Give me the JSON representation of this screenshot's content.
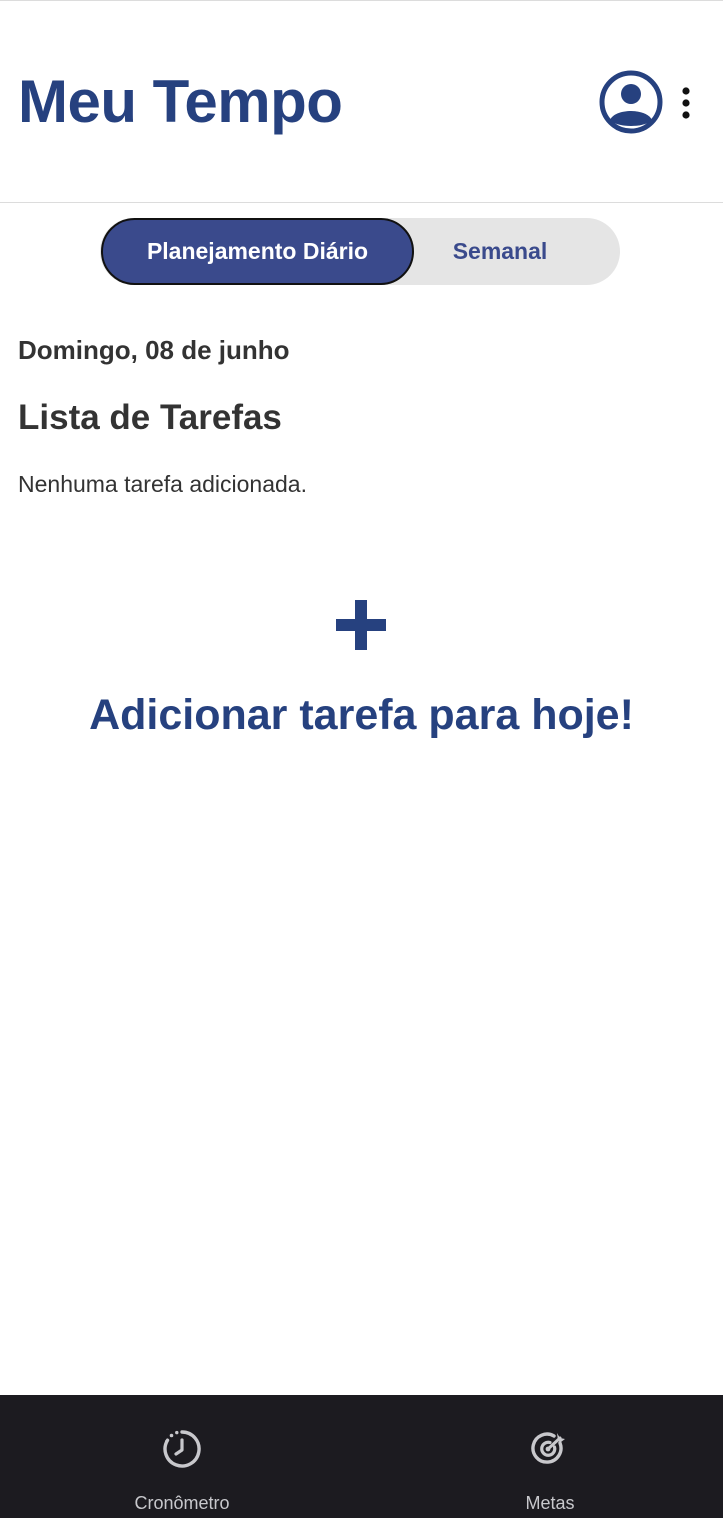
{
  "header": {
    "title": "Meu Tempo",
    "profile_icon": "account-circle-icon",
    "menu_icon": "more-vert-icon",
    "accent_color": "#26417f"
  },
  "tabs": {
    "items": [
      {
        "label": "Planejamento Diário",
        "active": true
      },
      {
        "label": "Semanal",
        "active": false
      }
    ],
    "active_color": "#3a4a8c",
    "inactive_bg": "#e5e5e5"
  },
  "main": {
    "date": "Domingo, 08 de junho",
    "list_title": "Lista de Tarefas",
    "empty_message": "Nenhuma tarefa adicionada.",
    "add_task": {
      "icon": "plus-icon",
      "label": "Adicionar tarefa para hoje!"
    }
  },
  "bottom_nav": {
    "items": [
      {
        "label": "Cronômetro",
        "icon": "timer-icon"
      },
      {
        "label": "Metas",
        "icon": "target-goal-icon"
      }
    ],
    "background": "#1c1b20"
  }
}
